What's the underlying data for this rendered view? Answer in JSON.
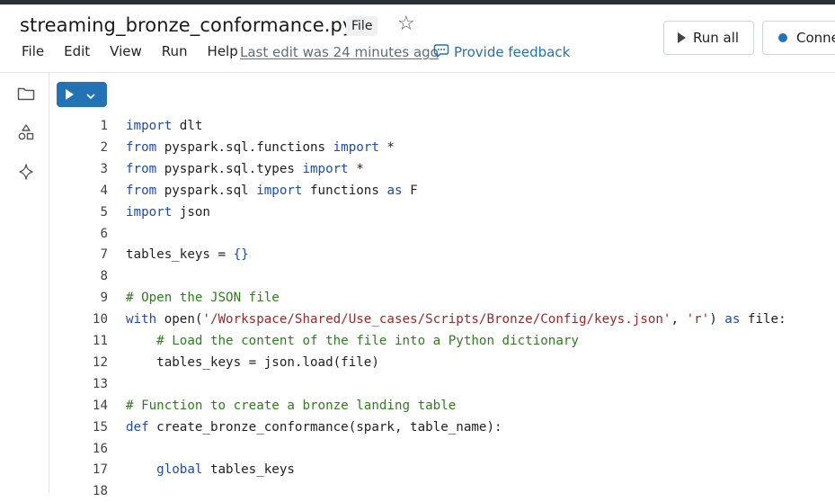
{
  "header": {
    "title": "streaming_bronze_conformance.py",
    "file_badge": "File",
    "menu": [
      "File",
      "Edit",
      "View",
      "Run",
      "Help"
    ],
    "last_edit": "Last edit was 24 minutes ago",
    "feedback": "Provide feedback",
    "run_all": "Run all",
    "connect": "Conne"
  },
  "sidebar": {
    "icons": [
      "folder-icon",
      "shapes-icon",
      "sparkle-icon"
    ]
  },
  "colors": {
    "accent": "#2272b4",
    "keyword": "#1d4ab6",
    "string": "#a22626",
    "comment": "#2e7d1e"
  },
  "code": {
    "lines": [
      {
        "n": "1",
        "segs": [
          [
            "kw",
            "import"
          ],
          [
            "t",
            " dlt"
          ]
        ]
      },
      {
        "n": "2",
        "segs": [
          [
            "kw",
            "from"
          ],
          [
            "t",
            " pyspark.sql.functions "
          ],
          [
            "kw",
            "import"
          ],
          [
            "t",
            " *"
          ]
        ]
      },
      {
        "n": "3",
        "segs": [
          [
            "kw",
            "from"
          ],
          [
            "t",
            " pyspark.sql.types "
          ],
          [
            "kw",
            "import"
          ],
          [
            "t",
            " *"
          ]
        ]
      },
      {
        "n": "4",
        "segs": [
          [
            "kw",
            "from"
          ],
          [
            "t",
            " pyspark.sql "
          ],
          [
            "kw",
            "import"
          ],
          [
            "t",
            " functions "
          ],
          [
            "kw",
            "as"
          ],
          [
            "t",
            " F"
          ]
        ]
      },
      {
        "n": "5",
        "segs": [
          [
            "kw",
            "import"
          ],
          [
            "t",
            " json"
          ]
        ]
      },
      {
        "n": "6",
        "segs": []
      },
      {
        "n": "7",
        "segs": [
          [
            "t",
            "tables_keys = "
          ],
          [
            "kw",
            "{}"
          ]
        ]
      },
      {
        "n": "8",
        "segs": []
      },
      {
        "n": "9",
        "segs": [
          [
            "cm",
            "# Open the JSON file"
          ]
        ]
      },
      {
        "n": "10",
        "segs": [
          [
            "kw",
            "with"
          ],
          [
            "t",
            " open("
          ],
          [
            "str",
            "'/Workspace/Shared/Use_cases/Scripts/Bronze/Config/keys.json'"
          ],
          [
            "t",
            ", "
          ],
          [
            "str",
            "'r'"
          ],
          [
            "t",
            ") "
          ],
          [
            "kw",
            "as"
          ],
          [
            "t",
            " file:"
          ]
        ]
      },
      {
        "n": "11",
        "segs": [
          [
            "t",
            "    "
          ],
          [
            "cm",
            "# Load the content of the file into a Python dictionary"
          ]
        ]
      },
      {
        "n": "12",
        "segs": [
          [
            "t",
            "    tables_keys = json.load(file)"
          ]
        ]
      },
      {
        "n": "13",
        "segs": []
      },
      {
        "n": "14",
        "segs": [
          [
            "cm",
            "# Function to create a bronze landing table"
          ]
        ]
      },
      {
        "n": "15",
        "segs": [
          [
            "kw",
            "def"
          ],
          [
            "t",
            " create_bronze_conformance(spark, table_name):"
          ]
        ]
      },
      {
        "n": "16",
        "segs": []
      },
      {
        "n": "17",
        "segs": [
          [
            "t",
            "    "
          ],
          [
            "kw",
            "global"
          ],
          [
            "t",
            " tables_keys"
          ]
        ]
      },
      {
        "n": "18",
        "segs": []
      }
    ]
  }
}
